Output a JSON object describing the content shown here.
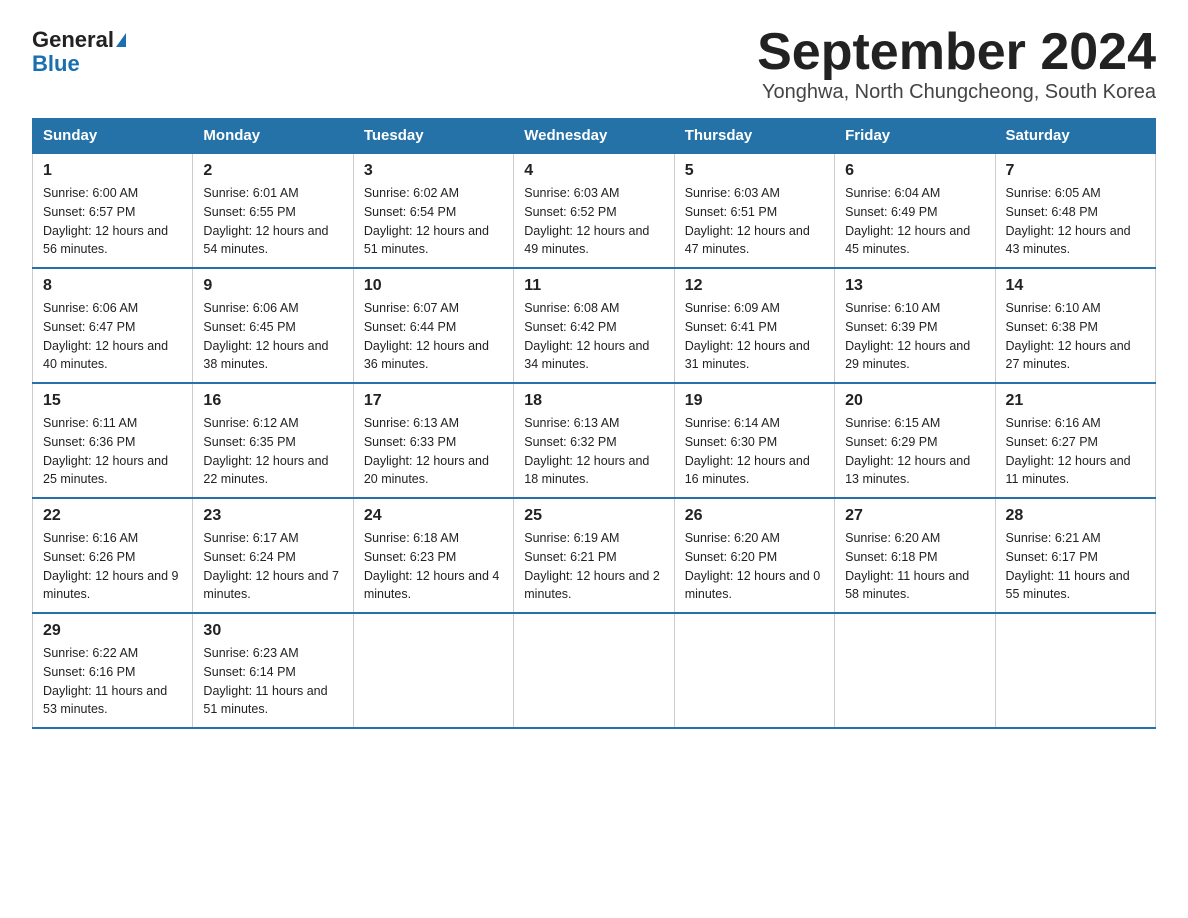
{
  "logo": {
    "general": "General",
    "blue": "Blue"
  },
  "header": {
    "month_title": "September 2024",
    "location": "Yonghwa, North Chungcheong, South Korea"
  },
  "weekdays": [
    "Sunday",
    "Monday",
    "Tuesday",
    "Wednesday",
    "Thursday",
    "Friday",
    "Saturday"
  ],
  "weeks": [
    [
      {
        "day": "1",
        "sunrise": "6:00 AM",
        "sunset": "6:57 PM",
        "daylight": "12 hours and 56 minutes."
      },
      {
        "day": "2",
        "sunrise": "6:01 AM",
        "sunset": "6:55 PM",
        "daylight": "12 hours and 54 minutes."
      },
      {
        "day": "3",
        "sunrise": "6:02 AM",
        "sunset": "6:54 PM",
        "daylight": "12 hours and 51 minutes."
      },
      {
        "day": "4",
        "sunrise": "6:03 AM",
        "sunset": "6:52 PM",
        "daylight": "12 hours and 49 minutes."
      },
      {
        "day": "5",
        "sunrise": "6:03 AM",
        "sunset": "6:51 PM",
        "daylight": "12 hours and 47 minutes."
      },
      {
        "day": "6",
        "sunrise": "6:04 AM",
        "sunset": "6:49 PM",
        "daylight": "12 hours and 45 minutes."
      },
      {
        "day": "7",
        "sunrise": "6:05 AM",
        "sunset": "6:48 PM",
        "daylight": "12 hours and 43 minutes."
      }
    ],
    [
      {
        "day": "8",
        "sunrise": "6:06 AM",
        "sunset": "6:47 PM",
        "daylight": "12 hours and 40 minutes."
      },
      {
        "day": "9",
        "sunrise": "6:06 AM",
        "sunset": "6:45 PM",
        "daylight": "12 hours and 38 minutes."
      },
      {
        "day": "10",
        "sunrise": "6:07 AM",
        "sunset": "6:44 PM",
        "daylight": "12 hours and 36 minutes."
      },
      {
        "day": "11",
        "sunrise": "6:08 AM",
        "sunset": "6:42 PM",
        "daylight": "12 hours and 34 minutes."
      },
      {
        "day": "12",
        "sunrise": "6:09 AM",
        "sunset": "6:41 PM",
        "daylight": "12 hours and 31 minutes."
      },
      {
        "day": "13",
        "sunrise": "6:10 AM",
        "sunset": "6:39 PM",
        "daylight": "12 hours and 29 minutes."
      },
      {
        "day": "14",
        "sunrise": "6:10 AM",
        "sunset": "6:38 PM",
        "daylight": "12 hours and 27 minutes."
      }
    ],
    [
      {
        "day": "15",
        "sunrise": "6:11 AM",
        "sunset": "6:36 PM",
        "daylight": "12 hours and 25 minutes."
      },
      {
        "day": "16",
        "sunrise": "6:12 AM",
        "sunset": "6:35 PM",
        "daylight": "12 hours and 22 minutes."
      },
      {
        "day": "17",
        "sunrise": "6:13 AM",
        "sunset": "6:33 PM",
        "daylight": "12 hours and 20 minutes."
      },
      {
        "day": "18",
        "sunrise": "6:13 AM",
        "sunset": "6:32 PM",
        "daylight": "12 hours and 18 minutes."
      },
      {
        "day": "19",
        "sunrise": "6:14 AM",
        "sunset": "6:30 PM",
        "daylight": "12 hours and 16 minutes."
      },
      {
        "day": "20",
        "sunrise": "6:15 AM",
        "sunset": "6:29 PM",
        "daylight": "12 hours and 13 minutes."
      },
      {
        "day": "21",
        "sunrise": "6:16 AM",
        "sunset": "6:27 PM",
        "daylight": "12 hours and 11 minutes."
      }
    ],
    [
      {
        "day": "22",
        "sunrise": "6:16 AM",
        "sunset": "6:26 PM",
        "daylight": "12 hours and 9 minutes."
      },
      {
        "day": "23",
        "sunrise": "6:17 AM",
        "sunset": "6:24 PM",
        "daylight": "12 hours and 7 minutes."
      },
      {
        "day": "24",
        "sunrise": "6:18 AM",
        "sunset": "6:23 PM",
        "daylight": "12 hours and 4 minutes."
      },
      {
        "day": "25",
        "sunrise": "6:19 AM",
        "sunset": "6:21 PM",
        "daylight": "12 hours and 2 minutes."
      },
      {
        "day": "26",
        "sunrise": "6:20 AM",
        "sunset": "6:20 PM",
        "daylight": "12 hours and 0 minutes."
      },
      {
        "day": "27",
        "sunrise": "6:20 AM",
        "sunset": "6:18 PM",
        "daylight": "11 hours and 58 minutes."
      },
      {
        "day": "28",
        "sunrise": "6:21 AM",
        "sunset": "6:17 PM",
        "daylight": "11 hours and 55 minutes."
      }
    ],
    [
      {
        "day": "29",
        "sunrise": "6:22 AM",
        "sunset": "6:16 PM",
        "daylight": "11 hours and 53 minutes."
      },
      {
        "day": "30",
        "sunrise": "6:23 AM",
        "sunset": "6:14 PM",
        "daylight": "11 hours and 51 minutes."
      },
      null,
      null,
      null,
      null,
      null
    ]
  ]
}
